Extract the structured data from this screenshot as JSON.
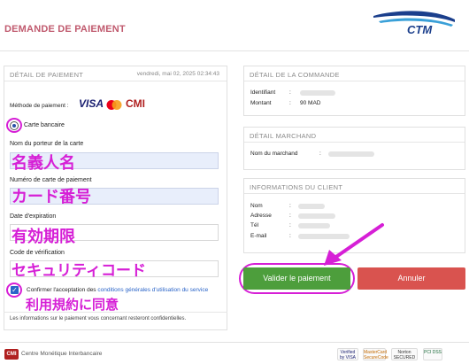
{
  "header": {
    "title": "DEMANDE DE PAIEMENT",
    "logo_text": "CTM"
  },
  "payment": {
    "title": "DÉTAIL DE PAIEMENT",
    "date": "vendredi, mai 02, 2025 02:34:43",
    "method_label": "Méthode de paiement :",
    "brands": [
      "VISA",
      "CMI"
    ],
    "card_option": "Carte bancaire",
    "holder_label": "Nom du porteur de la carte",
    "holder_annotation": "名義人名",
    "card_number_label": "Numéro de carte de paiement",
    "card_number_annotation": "カード番号",
    "expiry_label": "Date d'expiration",
    "expiry_annotation": "有効期限",
    "cvv_label": "Code de vérification",
    "cvv_annotation": "セキュリティコード",
    "consent_prefix": "Confirmer l'acceptation des ",
    "consent_link": "conditions générales d'utilisation du service",
    "terms_annotation": "利用規約に同意",
    "privacy_note": "Les informations sur le paiement vous concernant resteront confidentielles."
  },
  "order": {
    "title": "DÉTAIL DE LA COMMANDE",
    "id_label": "Identifiant",
    "amount_label": "Montant",
    "colon": ":",
    "amount_value": "90 MAD"
  },
  "merchant": {
    "title": "DÉTAIL MARCHAND",
    "name_label": "Nom du marchand"
  },
  "client": {
    "title": "INFORMATIONS DU CLIENT",
    "fields": [
      "Nom",
      "Adresse",
      "Tél",
      "E-mail"
    ]
  },
  "actions": {
    "validate": "Valider le paiement",
    "cancel": "Annuler"
  },
  "footer": {
    "cmi_logo": "CMI",
    "text": "Centre Monétique Interbancaire",
    "badges": [
      "Verified by VISA",
      "MasterCard SecureCode",
      "Norton SECURED",
      "PCI DSS"
    ]
  },
  "colors": {
    "annotation": "#d61fd6",
    "validate": "#4d9e3c",
    "cancel": "#d9534f",
    "title": "#c05a6e"
  }
}
